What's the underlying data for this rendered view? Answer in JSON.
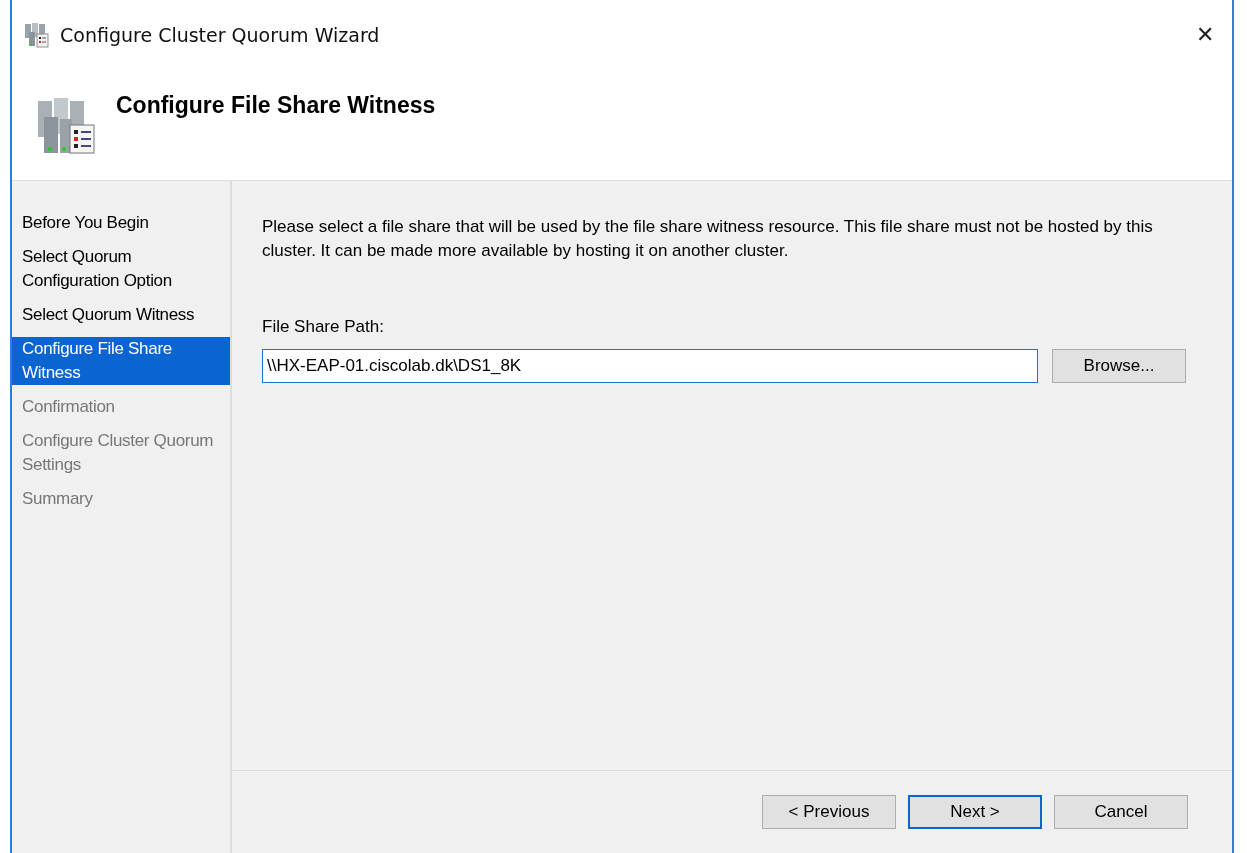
{
  "window": {
    "title": "Configure Cluster Quorum Wizard",
    "close": "✕"
  },
  "header": {
    "title": "Configure File Share Witness"
  },
  "steps": [
    {
      "label": "Before You Begin",
      "selected": false,
      "disabled": false
    },
    {
      "label": "Select Quorum Configuration Option",
      "selected": false,
      "disabled": false
    },
    {
      "label": "Select Quorum Witness",
      "selected": false,
      "disabled": false
    },
    {
      "label": "Configure File Share Witness",
      "selected": true,
      "disabled": false
    },
    {
      "label": "Confirmation",
      "selected": false,
      "disabled": true
    },
    {
      "label": "Configure Cluster Quorum Settings",
      "selected": false,
      "disabled": true
    },
    {
      "label": "Summary",
      "selected": false,
      "disabled": true
    }
  ],
  "description": "Please select a file share that will be used by the file share witness resource.  This file share must not be hosted by this cluster.  It can be made more available by hosting it on another cluster.",
  "path_field": {
    "label": "File Share Path:",
    "value": "\\\\HX-EAP-01.ciscolab.dk\\DS1_8K"
  },
  "browse_button": "Browse...",
  "buttons": [
    {
      "label": "< Previous",
      "default": false
    },
    {
      "label": "Next >",
      "default": true
    },
    {
      "label": "Cancel",
      "default": false
    }
  ]
}
